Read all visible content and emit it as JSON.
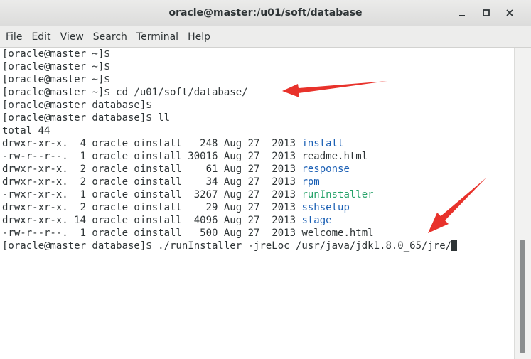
{
  "window": {
    "title": "oracle@master:/u01/soft/database",
    "controls": {
      "minimize": "‒",
      "maximize": "▢",
      "close": "✕"
    }
  },
  "menu": {
    "items": [
      "File",
      "Edit",
      "View",
      "Search",
      "Terminal",
      "Help"
    ]
  },
  "terminal": {
    "prompt_home": "[oracle@master ~]$",
    "prompt_db": "[oracle@master database]$",
    "cmd_cd": " cd /u01/soft/database/",
    "cmd_ll": " ll",
    "total": "total 44",
    "listing": [
      {
        "meta": "drwxr-xr-x.  4 oracle oinstall   248 Aug 27  2013 ",
        "name": "install",
        "type": "dir"
      },
      {
        "meta": "-rw-r--r--.  1 oracle oinstall 30016 Aug 27  2013 ",
        "name": "readme.html",
        "type": "file"
      },
      {
        "meta": "drwxr-xr-x.  2 oracle oinstall    61 Aug 27  2013 ",
        "name": "response",
        "type": "dir"
      },
      {
        "meta": "drwxr-xr-x.  2 oracle oinstall    34 Aug 27  2013 ",
        "name": "rpm",
        "type": "dir"
      },
      {
        "meta": "-rwxr-xr-x.  1 oracle oinstall  3267 Aug 27  2013 ",
        "name": "runInstaller",
        "type": "exec"
      },
      {
        "meta": "drwxr-xr-x.  2 oracle oinstall    29 Aug 27  2013 ",
        "name": "sshsetup",
        "type": "dir"
      },
      {
        "meta": "drwxr-xr-x. 14 oracle oinstall  4096 Aug 27  2013 ",
        "name": "stage",
        "type": "dir"
      },
      {
        "meta": "-rw-r--r--.  1 oracle oinstall   500 Aug 27  2013 ",
        "name": "welcome.html",
        "type": "file"
      }
    ],
    "cmd_run": " ./runInstaller -jreLoc /usr/java/jdk1.8.0_65/jre/"
  },
  "colors": {
    "directory": "#1a5fb4",
    "executable": "#26a269",
    "arrow": "#e8322b"
  }
}
